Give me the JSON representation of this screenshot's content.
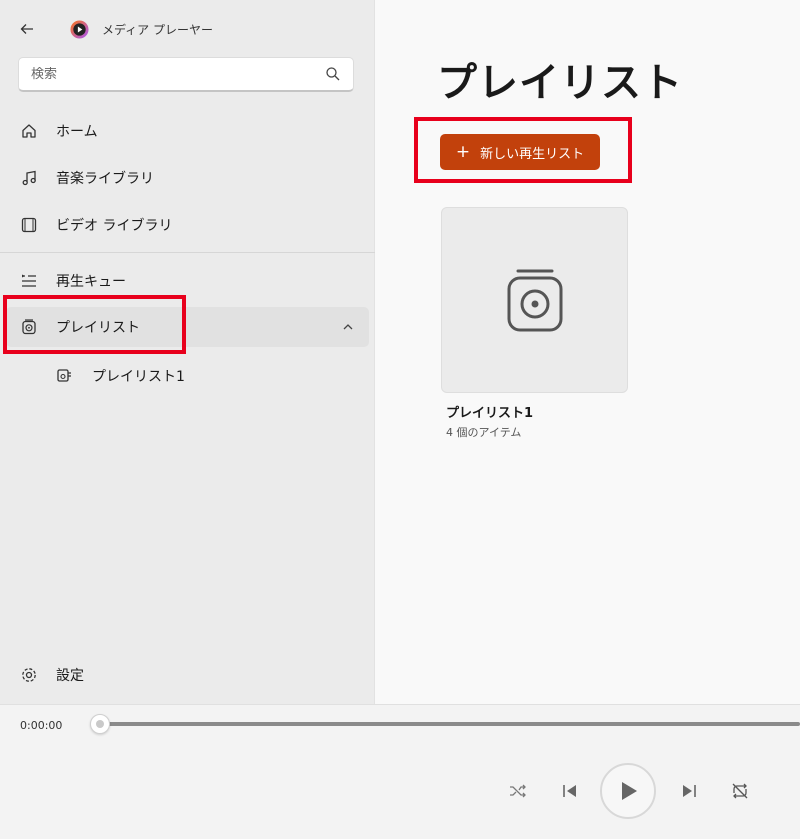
{
  "app": {
    "title": "メディア プレーヤー"
  },
  "search": {
    "placeholder": "検索"
  },
  "nav": {
    "home": "ホーム",
    "music": "音楽ライブラリ",
    "video": "ビデオ ライブラリ",
    "queue": "再生キュー",
    "playlists": "プレイリスト",
    "playlist_child": "プレイリスト1",
    "settings": "設定"
  },
  "main": {
    "title": "プレイリスト",
    "new_button": "新しい再生リスト",
    "tiles": [
      {
        "title": "プレイリスト1",
        "subtitle": "4 個のアイテム"
      }
    ]
  },
  "player": {
    "time": "0:00:00"
  },
  "colors": {
    "accent": "#c2410c",
    "highlight": "#e8001c"
  }
}
